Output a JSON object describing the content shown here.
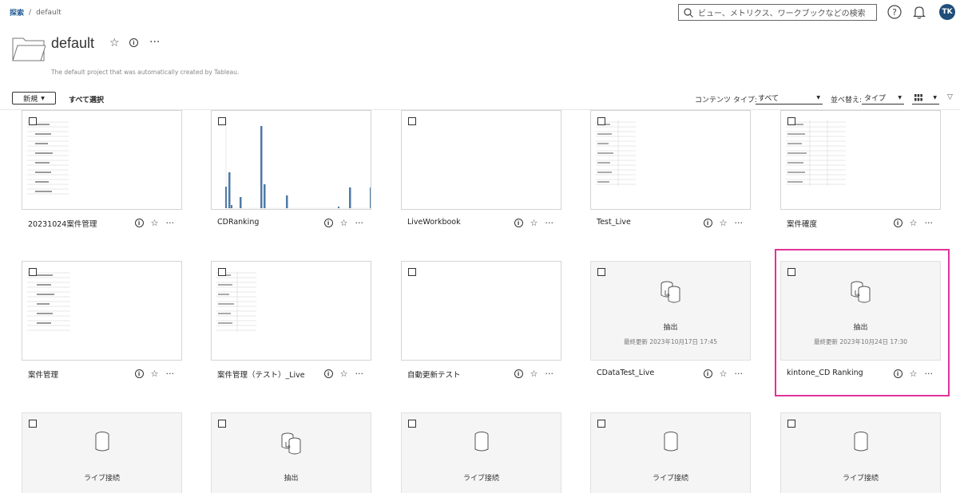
{
  "breadcrumb": {
    "root": "探索",
    "separator": "/",
    "current": "default"
  },
  "search": {
    "placeholder": "ビュー、メトリクス、ワークブックなどの検索"
  },
  "user": {
    "initials": "TK"
  },
  "project": {
    "title": "default",
    "description": "The default project that was automatically created by Tableau."
  },
  "toolbar": {
    "new_label": "新規",
    "select_all": "すべて選択",
    "content_type_label": "コンテンツ タイプ:",
    "content_type_value": "すべて",
    "sort_label": "並べ替え:",
    "sort_value": "タイプ"
  },
  "colors": {
    "accent": "#1f5a94",
    "highlight": "#e0339b",
    "bar": "#4e79a7"
  },
  "cards": [
    {
      "name": "20231024案件管理",
      "kind": "workbook"
    },
    {
      "name": "CDRanking",
      "kind": "workbook"
    },
    {
      "name": "LiveWorkbook",
      "kind": "workbook"
    },
    {
      "name": "Test_Live",
      "kind": "workbook"
    },
    {
      "name": "案件確度",
      "kind": "workbook"
    },
    {
      "name": "案件管理",
      "kind": "workbook"
    },
    {
      "name": "案件管理（テスト）_Live",
      "kind": "workbook"
    },
    {
      "name": "自動更新テスト",
      "kind": "workbook"
    },
    {
      "name": "CDataTest_Live",
      "kind": "extract",
      "label": "抽出",
      "sub": "最終更新 2023年10月17日 17:45"
    },
    {
      "name": "kintone_CD Ranking",
      "kind": "extract",
      "label": "抽出",
      "sub": "最終更新 2023年10月24日 17:30"
    },
    {
      "kind": "live",
      "label": "ライブ接続"
    },
    {
      "kind": "extract",
      "label": "抽出"
    },
    {
      "kind": "live",
      "label": "ライブ接続"
    },
    {
      "kind": "live",
      "label": "ライブ接続"
    },
    {
      "kind": "live",
      "label": "ライブ接続"
    }
  ],
  "icons": [
    "search-icon",
    "help-icon",
    "bell-icon",
    "folder-icon",
    "star-icon",
    "info-icon",
    "more-icon",
    "grid-icon",
    "chevron-down-icon",
    "database-icon",
    "extract-icon"
  ]
}
